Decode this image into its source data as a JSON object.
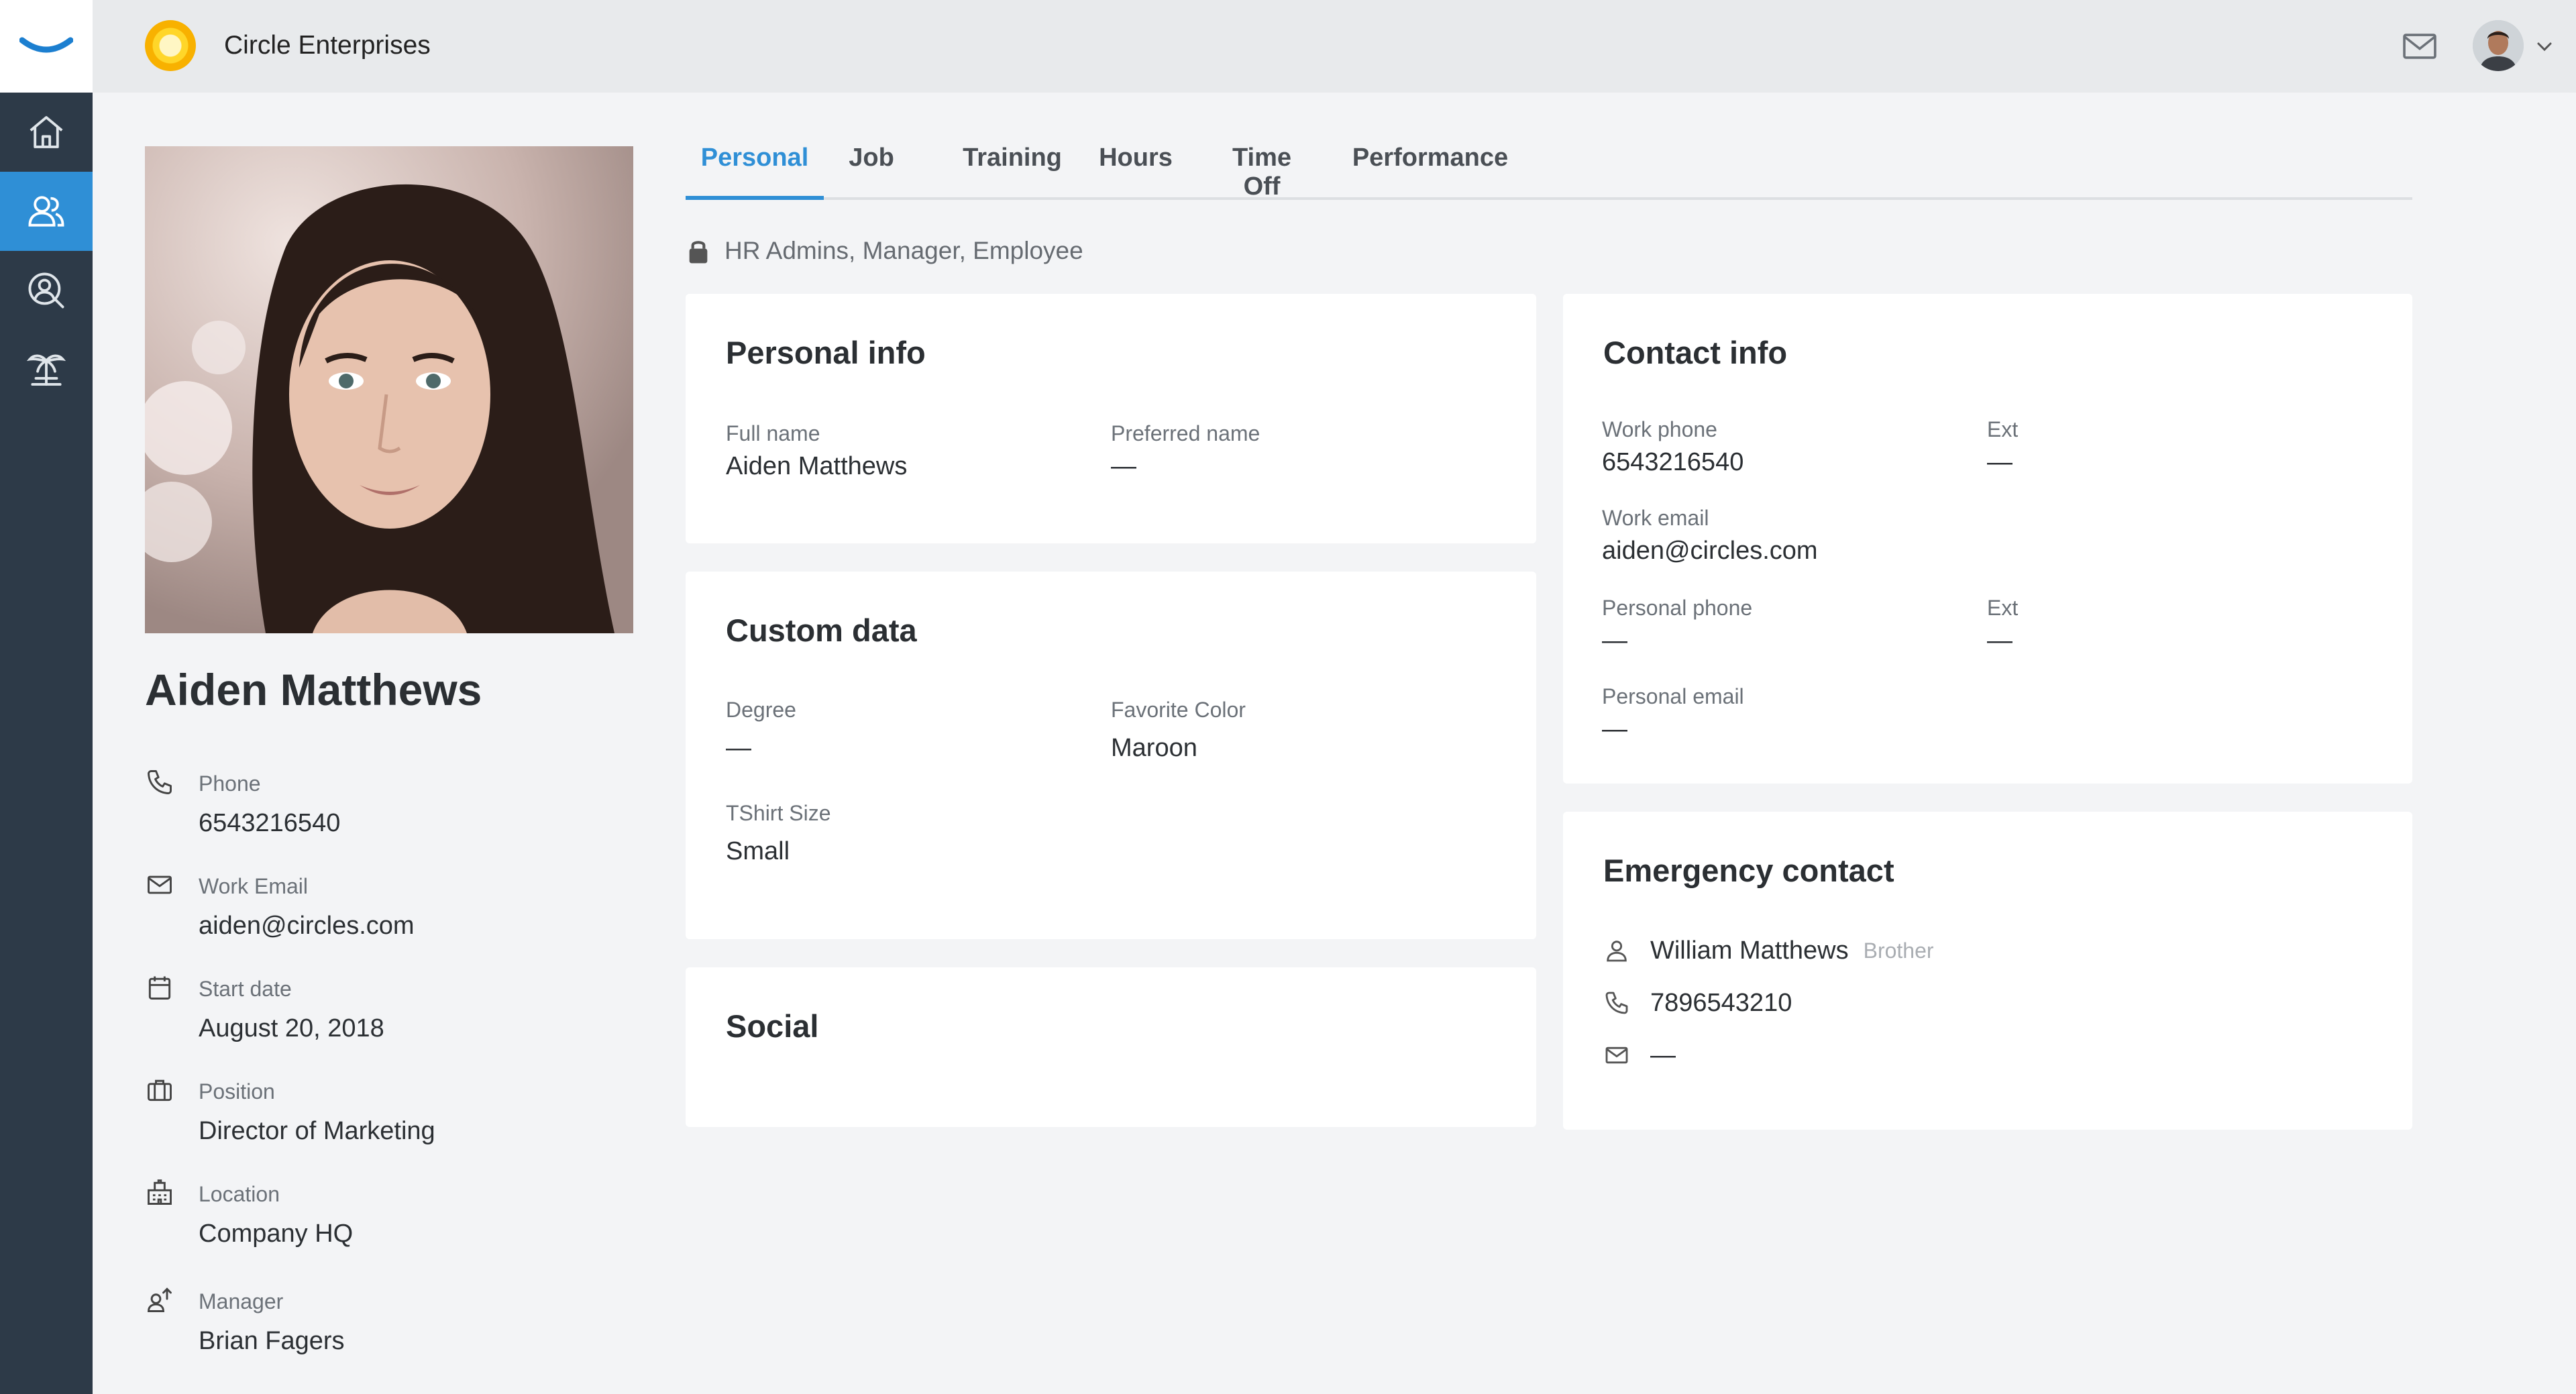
{
  "app": {
    "company_name": "Circle Enterprises"
  },
  "nav": [
    {
      "name": "home",
      "icon": "home-icon"
    },
    {
      "name": "people",
      "icon": "people-icon",
      "active": true
    },
    {
      "name": "search-people",
      "icon": "person-search-icon"
    },
    {
      "name": "time-off",
      "icon": "palm-tree-icon"
    }
  ],
  "profile": {
    "name": "Aiden Matthews",
    "fields": [
      {
        "icon": "phone-icon",
        "label": "Phone",
        "value": "6543216540"
      },
      {
        "icon": "mail-icon",
        "label": "Work Email",
        "value": "aiden@circles.com"
      },
      {
        "icon": "calendar-icon",
        "label": "Start date",
        "value": "August 20, 2018"
      },
      {
        "icon": "briefcase-icon",
        "label": "Position",
        "value": "Director of Marketing"
      },
      {
        "icon": "building-icon",
        "label": "Location",
        "value": "Company HQ"
      },
      {
        "icon": "manager-icon",
        "label": "Manager",
        "value": "Brian Fagers"
      }
    ]
  },
  "tabs": [
    {
      "label": "Personal",
      "active": true
    },
    {
      "label": "Job"
    },
    {
      "label": "Training"
    },
    {
      "label": "Hours"
    },
    {
      "label": "Time Off"
    },
    {
      "label": "Performance"
    }
  ],
  "access_text": "HR Admins, Manager, Employee",
  "personal_info": {
    "title": "Personal info",
    "full_name_label": "Full name",
    "full_name": "Aiden Matthews",
    "preferred_name_label": "Preferred name",
    "preferred_name": "—"
  },
  "custom_data": {
    "title": "Custom data",
    "degree_label": "Degree",
    "degree": "—",
    "favorite_color_label": "Favorite Color",
    "favorite_color": "Maroon",
    "tshirt_label": "TShirt Size",
    "tshirt": "Small"
  },
  "social": {
    "title": "Social"
  },
  "contact_info": {
    "title": "Contact info",
    "work_phone_label": "Work phone",
    "work_phone": "6543216540",
    "work_ext_label": "Ext",
    "work_ext": "—",
    "work_email_label": "Work email",
    "work_email": "aiden@circles.com",
    "personal_phone_label": "Personal phone",
    "personal_phone": "—",
    "personal_ext_label": "Ext",
    "personal_ext": "—",
    "personal_email_label": "Personal email",
    "personal_email": "—"
  },
  "emergency_contact": {
    "title": "Emergency contact",
    "name": "William Matthews",
    "relation": "Brother",
    "phone": "7896543210",
    "email": "—"
  },
  "colors": {
    "accent": "#2f8fd6",
    "rail": "#2d3a48",
    "topbar": "#e8eaec",
    "background": "#f3f4f6"
  }
}
